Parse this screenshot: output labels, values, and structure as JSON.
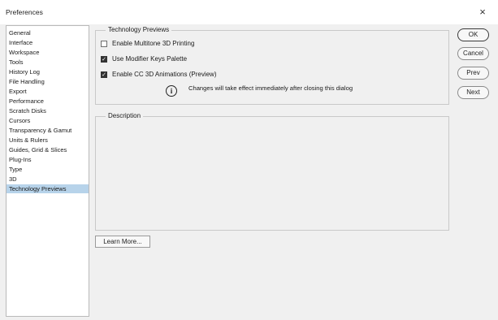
{
  "window": {
    "title": "Preferences",
    "close_glyph": "×"
  },
  "sidebar": {
    "items": [
      {
        "label": "General"
      },
      {
        "label": "Interface"
      },
      {
        "label": "Workspace"
      },
      {
        "label": "Tools"
      },
      {
        "label": "History Log"
      },
      {
        "label": "File Handling"
      },
      {
        "label": "Export"
      },
      {
        "label": "Performance"
      },
      {
        "label": "Scratch Disks"
      },
      {
        "label": "Cursors"
      },
      {
        "label": "Transparency & Gamut"
      },
      {
        "label": "Units & Rulers"
      },
      {
        "label": "Guides, Grid & Slices"
      },
      {
        "label": "Plug-Ins"
      },
      {
        "label": "Type"
      },
      {
        "label": "3D"
      },
      {
        "label": "Technology Previews",
        "selected": true
      }
    ]
  },
  "tech_previews": {
    "legend": "Technology Previews",
    "options": [
      {
        "label": "Enable Multitone 3D Printing",
        "checked": false
      },
      {
        "label": "Use Modifier Keys Palette",
        "checked": true
      },
      {
        "label": "Enable CC 3D Animations (Preview)",
        "checked": true
      }
    ],
    "info_glyph": "i",
    "info_text": "Changes will take effect immediately after closing this dialog"
  },
  "description": {
    "legend": "Description"
  },
  "buttons": {
    "ok": "OK",
    "cancel": "Cancel",
    "prev": "Prev",
    "next": "Next",
    "learn_more": "Learn More..."
  },
  "check_glyph": "✓"
}
